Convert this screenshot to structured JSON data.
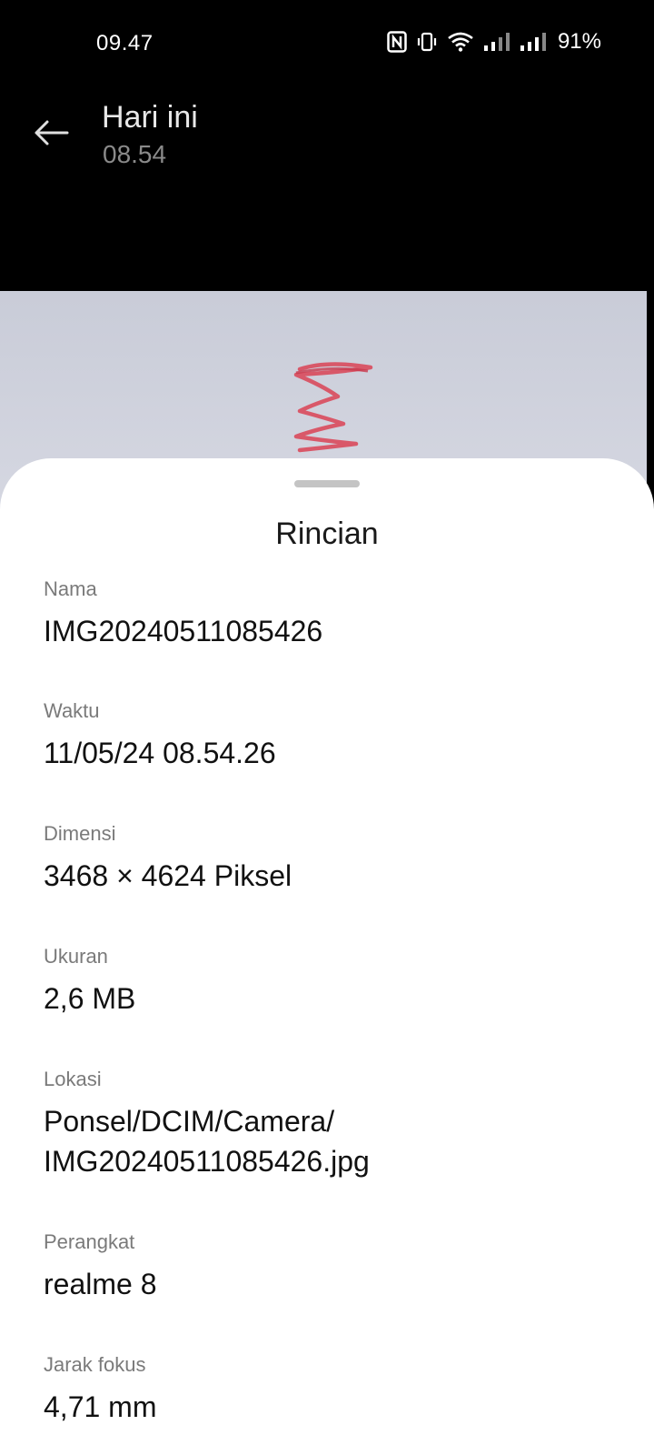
{
  "status_bar": {
    "time": "09.47",
    "battery": "91%",
    "icons": [
      "nfc-icon",
      "vibrate-icon",
      "wifi-icon",
      "signal-icon",
      "signal-icon"
    ]
  },
  "header": {
    "back_icon": "arrow-left-icon",
    "title": "Hari ini",
    "subtitle": "08.54"
  },
  "sheet": {
    "title": "Rincian",
    "fields": [
      {
        "label": "Nama",
        "value": "IMG20240511085426"
      },
      {
        "label": "Waktu",
        "value": "11/05/24 08.54.26"
      },
      {
        "label": "Dimensi",
        "value": "3468 × 4624 Piksel"
      },
      {
        "label": "Ukuran",
        "value": "2,6 MB"
      },
      {
        "label": "Lokasi",
        "value_lines": [
          "Ponsel/DCIM/Camera/",
          "IMG20240511085426.jpg"
        ]
      },
      {
        "label": "Perangkat",
        "value": "realme 8"
      },
      {
        "label": "Jarak fokus",
        "value": "4,71 mm"
      }
    ]
  },
  "colors": {
    "background": "#000000",
    "sheet": "#ffffff",
    "photo_ink": "#d94a5c"
  }
}
